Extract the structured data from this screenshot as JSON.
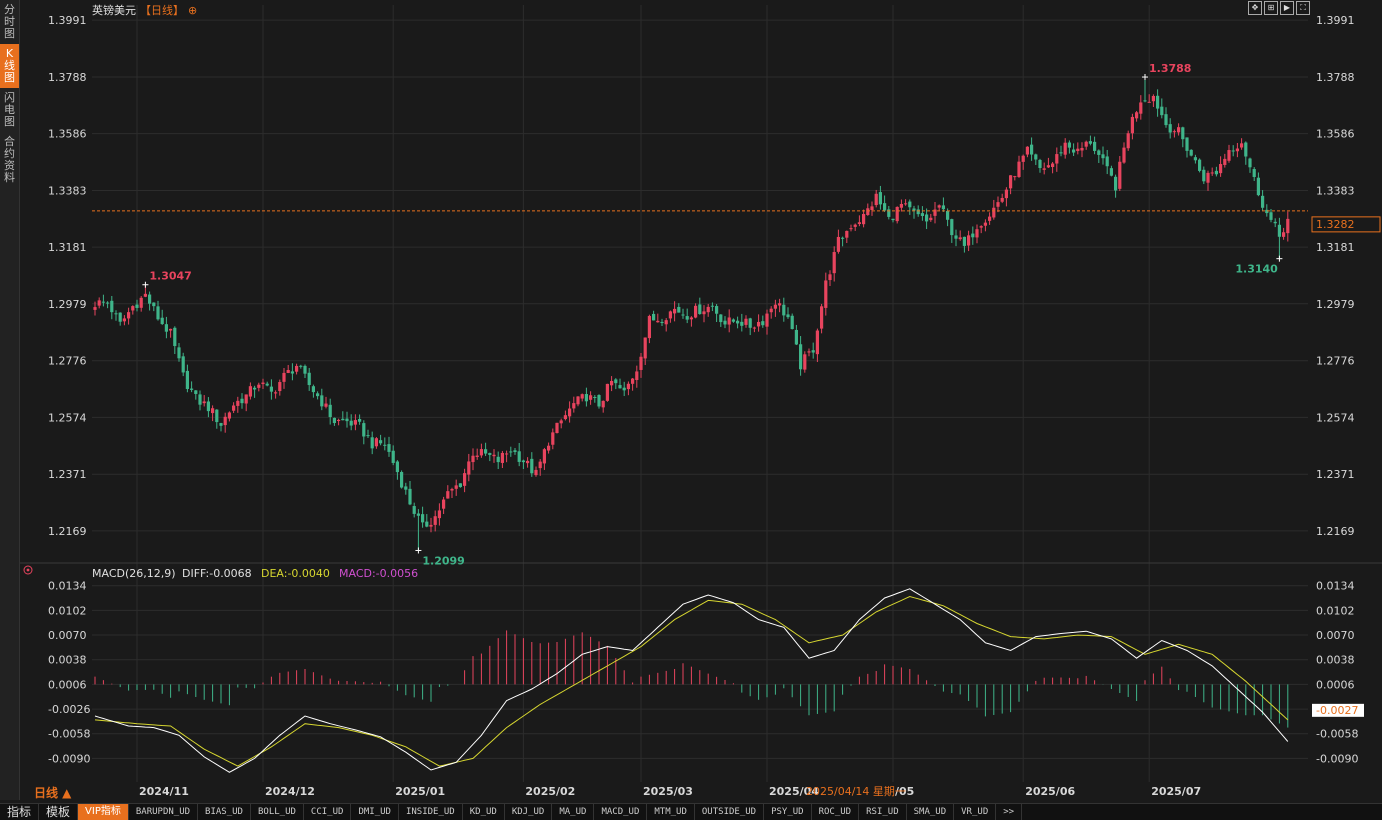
{
  "side_tabs": [
    {
      "label": "分时图",
      "active": false
    },
    {
      "label": "K线图",
      "active": true
    },
    {
      "label": "闪电图",
      "active": false
    },
    {
      "label": "合约资料",
      "active": false
    }
  ],
  "header": {
    "symbol": "英镑美元",
    "period": "【日线】",
    "add_icon": "⊕"
  },
  "toolbox_icons": [
    "move-icon",
    "fit-icon",
    "play-icon",
    "fullscreen-icon"
  ],
  "colors": {
    "up": "#e8445e",
    "down": "#3fb58a",
    "diff": "#ffffff",
    "dea": "#d6d630",
    "macd_label": "#d050d0",
    "accent": "#e8701e",
    "grid": "#2c2c2c"
  },
  "bottom_bar": {
    "period": "日线 ▲",
    "tabs": [
      "指标",
      "模板",
      "VIP指标"
    ],
    "indicators": [
      "BARUPDN_UD",
      "BIAS_UD",
      "BOLL_UD",
      "CCI_UD",
      "DMI_UD",
      "INSIDE_UD",
      "KD_UD",
      "KDJ_UD",
      "MA_UD",
      "MACD_UD",
      "MTM_UD",
      "OUTSIDE_UD",
      "PSY_UD",
      "ROC_UD",
      "RSI_UD",
      "SMA_UD",
      "VR_UD"
    ],
    "more": ">>"
  },
  "cursor_date": "2025/04/14 星期一",
  "macd_header": {
    "title": "MACD(26,12,9)",
    "diff_label": "DIFF:-0.0068",
    "dea_label": "DEA:-0.0040",
    "macd_label": "MACD:-0.0056"
  },
  "chart_data": [
    {
      "type": "candlestick",
      "title": "英镑美元",
      "y_ticks": [
        "1.3991",
        "1.3788",
        "1.3586",
        "1.3383",
        "1.3181",
        "1.2979",
        "1.2776",
        "1.2574",
        "1.2371",
        "1.2169"
      ],
      "ylim": [
        1.2065,
        1.4045
      ],
      "x_ticks": [
        {
          "label": "2024/11",
          "index": 10
        },
        {
          "label": "2024/12",
          "index": 40
        },
        {
          "label": "2025/01",
          "index": 71
        },
        {
          "label": "2025/02",
          "index": 102
        },
        {
          "label": "2025/03",
          "index": 130
        },
        {
          "label": "2025/04",
          "index": 160
        },
        {
          "label": "/05",
          "index": 190
        },
        {
          "label": "2025/06",
          "index": 221
        },
        {
          "label": "2025/07",
          "index": 251
        }
      ],
      "annotations": [
        {
          "text": "1.3047",
          "index": 12,
          "value": 1.3047,
          "kind": "high"
        },
        {
          "text": "1.2099",
          "index": 77,
          "value": 1.2099,
          "kind": "low"
        },
        {
          "text": "1.3788",
          "index": 250,
          "value": 1.3788,
          "kind": "high"
        },
        {
          "text": "1.3140",
          "index": 282,
          "value": 1.314,
          "kind": "low"
        }
      ],
      "last_price": {
        "text": "1.3282",
        "value": 1.3282
      },
      "anchors": [
        [
          0,
          1.298
        ],
        [
          3,
          1.2985
        ],
        [
          6,
          1.2905
        ],
        [
          9,
          1.297
        ],
        [
          12,
          1.301
        ],
        [
          15,
          1.293
        ],
        [
          18,
          1.287
        ],
        [
          21,
          1.272
        ],
        [
          24,
          1.264
        ],
        [
          27,
          1.261
        ],
        [
          30,
          1.255
        ],
        [
          33,
          1.262
        ],
        [
          36,
          1.265
        ],
        [
          39,
          1.27
        ],
        [
          42,
          1.266
        ],
        [
          45,
          1.272
        ],
        [
          48,
          1.276
        ],
        [
          51,
          1.269
        ],
        [
          54,
          1.263
        ],
        [
          57,
          1.256
        ],
        [
          60,
          1.256
        ],
        [
          63,
          1.254
        ],
        [
          66,
          1.248
        ],
        [
          69,
          1.248
        ],
        [
          72,
          1.238
        ],
        [
          75,
          1.227
        ],
        [
          78,
          1.218
        ],
        [
          81,
          1.222
        ],
        [
          84,
          1.23
        ],
        [
          87,
          1.234
        ],
        [
          90,
          1.245
        ],
        [
          93,
          1.244
        ],
        [
          96,
          1.242
        ],
        [
          99,
          1.246
        ],
        [
          102,
          1.242
        ],
        [
          105,
          1.237
        ],
        [
          108,
          1.249
        ],
        [
          111,
          1.256
        ],
        [
          114,
          1.262
        ],
        [
          117,
          1.265
        ],
        [
          120,
          1.262
        ],
        [
          123,
          1.27
        ],
        [
          126,
          1.266
        ],
        [
          129,
          1.275
        ],
        [
          132,
          1.292
        ],
        [
          135,
          1.293
        ],
        [
          138,
          1.296
        ],
        [
          141,
          1.294
        ],
        [
          144,
          1.296
        ],
        [
          147,
          1.297
        ],
        [
          150,
          1.291
        ],
        [
          153,
          1.292
        ],
        [
          156,
          1.29
        ],
        [
          159,
          1.292
        ],
        [
          162,
          1.299
        ],
        [
          165,
          1.293
        ],
        [
          168,
          1.276
        ],
        [
          171,
          1.282
        ],
        [
          174,
          1.305
        ],
        [
          177,
          1.32
        ],
        [
          180,
          1.326
        ],
        [
          183,
          1.329
        ],
        [
          186,
          1.336
        ],
        [
          189,
          1.328
        ],
        [
          192,
          1.333
        ],
        [
          195,
          1.33
        ],
        [
          198,
          1.327
        ],
        [
          201,
          1.333
        ],
        [
          204,
          1.324
        ],
        [
          207,
          1.318
        ],
        [
          210,
          1.326
        ],
        [
          213,
          1.33
        ],
        [
          216,
          1.336
        ],
        [
          219,
          1.345
        ],
        [
          222,
          1.352
        ],
        [
          225,
          1.346
        ],
        [
          228,
          1.348
        ],
        [
          231,
          1.355
        ],
        [
          234,
          1.352
        ],
        [
          237,
          1.356
        ],
        [
          240,
          1.348
        ],
        [
          243,
          1.34
        ],
        [
          246,
          1.36
        ],
        [
          249,
          1.371
        ],
        [
          252,
          1.372
        ],
        [
          255,
          1.362
        ],
        [
          258,
          1.359
        ],
        [
          261,
          1.351
        ],
        [
          264,
          1.343
        ],
        [
          267,
          1.345
        ],
        [
          270,
          1.353
        ],
        [
          273,
          1.356
        ],
        [
          276,
          1.342
        ],
        [
          279,
          1.33
        ],
        [
          282,
          1.322
        ],
        [
          284,
          1.3282
        ]
      ]
    },
    {
      "type": "line+bar",
      "title": "MACD(26,12,9)",
      "y_ticks": [
        "0.0134",
        "0.0102",
        "0.0070",
        "0.0038",
        "0.0006",
        "-0.0026",
        "-0.0058",
        "-0.0090"
      ],
      "ylim": [
        -0.0118,
        0.0144
      ],
      "cursor_value": "-0.0027",
      "series": [
        {
          "name": "DIFF",
          "value": -0.0068
        },
        {
          "name": "DEA",
          "value": -0.004
        },
        {
          "name": "MACD",
          "value": -0.0056
        }
      ],
      "diff_anchors": [
        [
          0,
          -0.0035
        ],
        [
          8,
          -0.0048
        ],
        [
          14,
          -0.005
        ],
        [
          20,
          -0.006
        ],
        [
          26,
          -0.0088
        ],
        [
          32,
          -0.0108
        ],
        [
          38,
          -0.009
        ],
        [
          44,
          -0.006
        ],
        [
          50,
          -0.0035
        ],
        [
          56,
          -0.0045
        ],
        [
          62,
          -0.0053
        ],
        [
          68,
          -0.0062
        ],
        [
          74,
          -0.0082
        ],
        [
          80,
          -0.0105
        ],
        [
          86,
          -0.0095
        ],
        [
          92,
          -0.006
        ],
        [
          98,
          -0.0015
        ],
        [
          104,
          0.0
        ],
        [
          110,
          0.002
        ],
        [
          116,
          0.0045
        ],
        [
          122,
          0.0055
        ],
        [
          128,
          0.005
        ],
        [
          134,
          0.008
        ],
        [
          140,
          0.011
        ],
        [
          146,
          0.0122
        ],
        [
          152,
          0.0112
        ],
        [
          158,
          0.009
        ],
        [
          164,
          0.008
        ],
        [
          170,
          0.004
        ],
        [
          176,
          0.005
        ],
        [
          182,
          0.009
        ],
        [
          188,
          0.0118
        ],
        [
          194,
          0.013
        ],
        [
          200,
          0.011
        ],
        [
          206,
          0.009
        ],
        [
          212,
          0.006
        ],
        [
          218,
          0.005
        ],
        [
          224,
          0.0068
        ],
        [
          230,
          0.0072
        ],
        [
          236,
          0.0075
        ],
        [
          242,
          0.0065
        ],
        [
          248,
          0.004
        ],
        [
          254,
          0.0063
        ],
        [
          260,
          0.005
        ],
        [
          266,
          0.003
        ],
        [
          272,
          0.0
        ],
        [
          278,
          -0.003
        ],
        [
          284,
          -0.0068
        ]
      ],
      "dea_anchors": [
        [
          0,
          -0.004
        ],
        [
          10,
          -0.0045
        ],
        [
          18,
          -0.0048
        ],
        [
          26,
          -0.0078
        ],
        [
          34,
          -0.01
        ],
        [
          42,
          -0.0075
        ],
        [
          50,
          -0.0045
        ],
        [
          58,
          -0.005
        ],
        [
          66,
          -0.006
        ],
        [
          74,
          -0.0075
        ],
        [
          82,
          -0.01
        ],
        [
          90,
          -0.009
        ],
        [
          98,
          -0.005
        ],
        [
          106,
          -0.002
        ],
        [
          114,
          0.0005
        ],
        [
          122,
          0.003
        ],
        [
          130,
          0.0055
        ],
        [
          138,
          0.009
        ],
        [
          146,
          0.0115
        ],
        [
          154,
          0.011
        ],
        [
          162,
          0.009
        ],
        [
          170,
          0.006
        ],
        [
          178,
          0.007
        ],
        [
          186,
          0.01
        ],
        [
          194,
          0.012
        ],
        [
          202,
          0.0108
        ],
        [
          210,
          0.0085
        ],
        [
          218,
          0.0068
        ],
        [
          226,
          0.0065
        ],
        [
          234,
          0.007
        ],
        [
          242,
          0.0068
        ],
        [
          250,
          0.0045
        ],
        [
          258,
          0.0058
        ],
        [
          266,
          0.0045
        ],
        [
          274,
          0.001
        ],
        [
          280,
          -0.002
        ],
        [
          284,
          -0.004
        ]
      ]
    }
  ]
}
